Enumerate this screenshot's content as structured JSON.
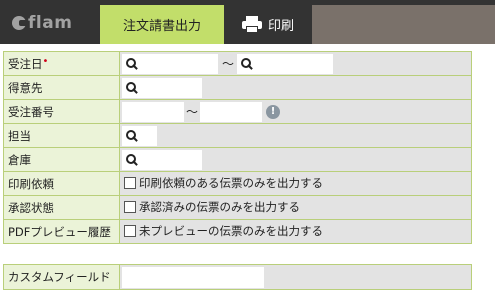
{
  "header": {
    "logo_text": "flam",
    "tabs": [
      {
        "label": "注文請書出力",
        "active": true
      },
      {
        "label": "印刷",
        "icon": "printer-icon"
      }
    ],
    "colors": {
      "bar": "#333333",
      "active_tab": "#c2de6a",
      "right_block": "#7a716a"
    }
  },
  "form": {
    "required_mark": "•",
    "tilde": "〜",
    "rows": [
      {
        "label": "受注日",
        "required": true
      },
      {
        "label": "得意先"
      },
      {
        "label": "受注番号"
      },
      {
        "label": "担当"
      },
      {
        "label": "倉庫"
      },
      {
        "label": "印刷依頼",
        "checkbox_label": "印刷依頼のある伝票のみを出力する"
      },
      {
        "label": "承認状態",
        "checkbox_label": "承認済みの伝票のみを出力する"
      },
      {
        "label": "PDFプレビュー履歴",
        "checkbox_label": "未プレビューの伝票のみを出力する"
      }
    ],
    "colors": {
      "label_bg": "#ebf3d8",
      "border": "#b9cf7a",
      "value_bg": "#e3e3e3"
    }
  },
  "custom": {
    "label": "カスタムフィールド"
  },
  "info_icon_text": "!"
}
